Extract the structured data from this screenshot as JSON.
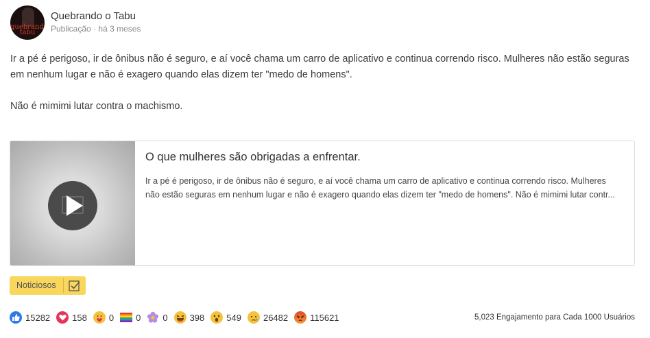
{
  "post": {
    "page_name": "Quebrando o Tabu",
    "avatar_text": "quebrando tabu",
    "type_label": "Publicação",
    "separator": "·",
    "time_ago": "há 3 meses",
    "paragraphs": [
      "Ir a pé é perigoso, ir de ônibus não é seguro, e aí você chama um carro de aplicativo e continua correndo risco. Mulheres não estão seguras em nenhum lugar e não é exagero quando elas dizem ter \"medo de homens\".",
      "Não é mimimi lutar contra o machismo."
    ]
  },
  "link_card": {
    "title": "O que mulheres são obrigadas a enfrentar.",
    "description": "Ir a pé é perigoso, ir de ônibus não é seguro, e aí você chama um carro de aplicativo e continua correndo risco. Mulheres não estão seguras em nenhum lugar e não é exagero quando elas dizem ter \"medo de homens\". Não é mimimi lutar contr..."
  },
  "tag": {
    "label": "Noticiosos",
    "icon": "check-icon",
    "color": "#f9d65c"
  },
  "reactions": [
    {
      "name": "like",
      "icon": "like-icon",
      "count": "15282",
      "color": "#2d7ae6"
    },
    {
      "name": "love",
      "icon": "heart-icon",
      "count": "158",
      "color": "#e8335a"
    },
    {
      "name": "care",
      "icon": "care-icon",
      "count": "0",
      "color": "#f5c33b"
    },
    {
      "name": "pride",
      "icon": "rainbow-flag-icon",
      "count": "0",
      "color": "#8f5bd6"
    },
    {
      "name": "thankful",
      "icon": "flower-icon",
      "count": "0",
      "color": "#a77be0"
    },
    {
      "name": "haha",
      "icon": "haha-icon",
      "count": "398",
      "color": "#f5c33b"
    },
    {
      "name": "wow",
      "icon": "wow-icon",
      "count": "549",
      "color": "#f5c33b"
    },
    {
      "name": "sad",
      "icon": "sad-icon",
      "count": "26482",
      "color": "#f5c33b"
    },
    {
      "name": "angry",
      "icon": "angry-icon",
      "count": "115621",
      "color": "#e8662b"
    }
  ],
  "engagement": "5,023 Engajamento para Cada 1000 Usuários"
}
